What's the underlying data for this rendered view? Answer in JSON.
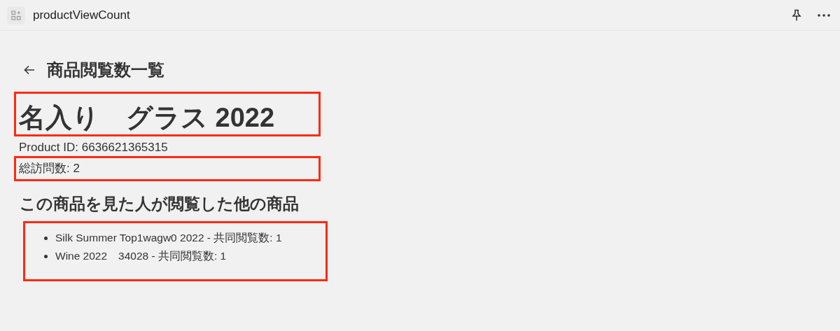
{
  "window": {
    "title": "productViewCount"
  },
  "page": {
    "heading": "商品閲覧数一覧"
  },
  "product": {
    "name": "名入り　グラス 2022",
    "id_line": "Product ID: 6636621365315",
    "visits": "総訪問数: 2"
  },
  "related": {
    "heading": "この商品を見た人が閲覧した他の商品",
    "items": [
      {
        "text": "Silk Summer Top1wagw0 2022 - 共同閲覧数: 1"
      },
      {
        "text": "Wine 2022　34028 - 共同閲覧数: 1"
      }
    ]
  }
}
